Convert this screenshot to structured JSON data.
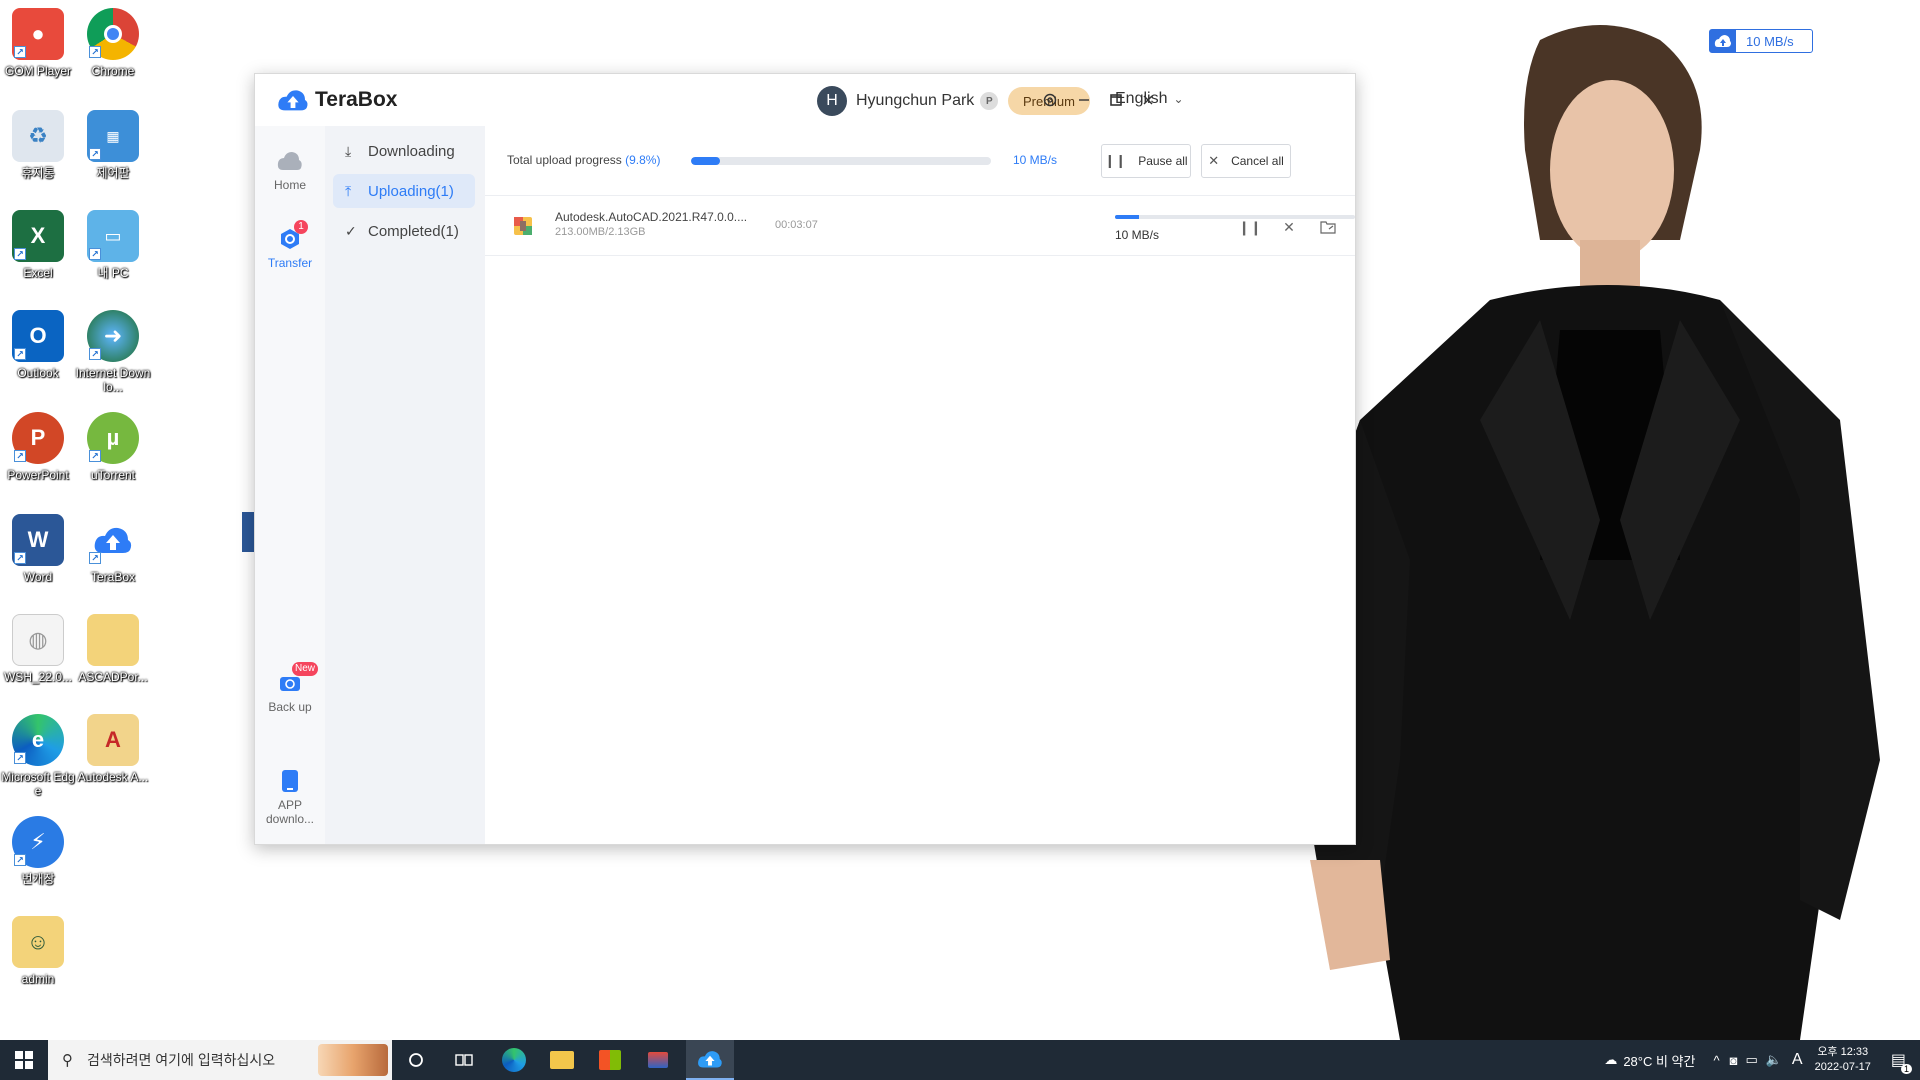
{
  "desktop": {
    "icons": [
      {
        "label": "GOM Player"
      },
      {
        "label": "Chrome"
      },
      {
        "label": "휴지통"
      },
      {
        "label": "제어판"
      },
      {
        "label": "Excel"
      },
      {
        "label": "내 PC"
      },
      {
        "label": "Outlook"
      },
      {
        "label": "Internet Downlo..."
      },
      {
        "label": "PowerPoint"
      },
      {
        "label": "uTorrent"
      },
      {
        "label": "Word"
      },
      {
        "label": "TeraBox"
      },
      {
        "label": "WSH_22.0..."
      },
      {
        "label": "ASCADPor..."
      },
      {
        "label": "Microsoft Edge"
      },
      {
        "label": "Autodesk A..."
      },
      {
        "label": "번개장"
      },
      {
        "label": "admin"
      }
    ]
  },
  "speed_widget": {
    "text": "10 MB/s"
  },
  "window": {
    "app_name": "TeraBox",
    "user": {
      "initial": "H",
      "name": "Hyungchun Park",
      "badge": "P"
    },
    "premium_label": "Premium",
    "language": "English",
    "nav": {
      "home": "Home",
      "transfer": "Transfer",
      "transfer_badge": "1",
      "backup": "Back up",
      "backup_badge": "New",
      "app_download": "APP downlo..."
    },
    "subnav": {
      "downloading": "Downloading",
      "uploading": "Uploading(1)",
      "completed": "Completed(1)"
    },
    "progress": {
      "label": "Total upload progress",
      "percent_text": "(9.8%)",
      "percent": 9.8,
      "speed": "10 MB/s",
      "pause_all": "Pause all",
      "cancel_all": "Cancel all"
    },
    "task": {
      "file_name": "Autodesk.AutoCAD.2021.R47.0.0....",
      "size": "213.00MB/2.13GB",
      "time": "00:03:07",
      "speed": "10 MB/s",
      "percent": 9.8
    }
  },
  "taskbar": {
    "search_placeholder": "검색하려면 여기에 입력하십시오",
    "weather": "28°C  비 약간",
    "ime": "A",
    "time": "오후 12:33",
    "date": "2022-07-17",
    "notification_count": "1"
  },
  "colors": {
    "accent": "#2e7cf6",
    "premium": "#f6d7a7",
    "taskbar": "#1f2a36"
  }
}
